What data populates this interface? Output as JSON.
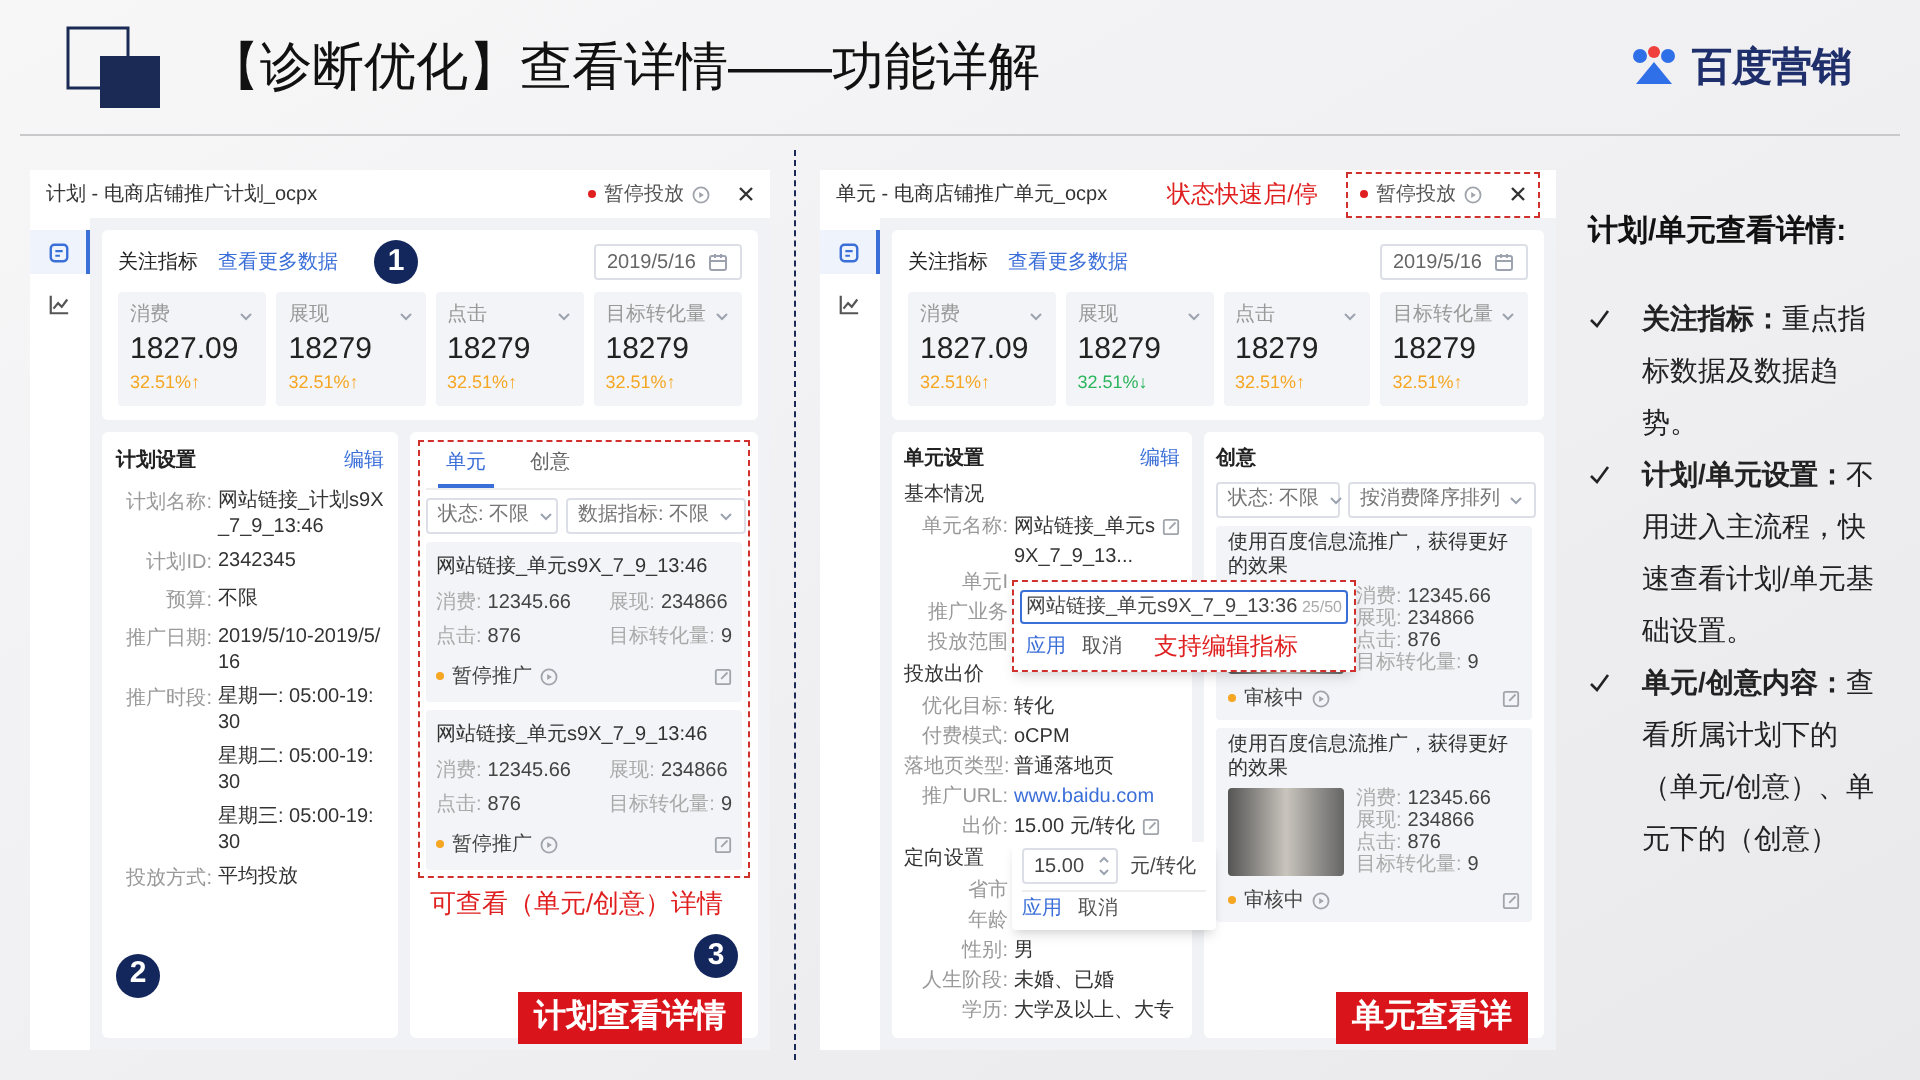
{
  "header": {
    "title": "【诊断优化】查看详情——功能详解",
    "brand": "百度营销"
  },
  "plan_view": {
    "title": "计划 - 电商店铺推广计划_ocpx",
    "status": "暂停投放",
    "nav": [
      {
        "kind": "document",
        "selected": true
      },
      {
        "kind": "chart",
        "selected": false
      }
    ],
    "metrics": {
      "heading": "关注指标",
      "link": "查看更多数据",
      "date": "2019/5/16",
      "badge": "1",
      "cards": [
        {
          "label": "消费",
          "value": "1827.09",
          "change": "32.51%↑",
          "color": "#f5a623"
        },
        {
          "label": "展现",
          "value": "18279",
          "change": "32.51%↑",
          "color": "#f5a623"
        },
        {
          "label": "点击",
          "value": "18279",
          "change": "32.51%↑",
          "color": "#f5a623"
        },
        {
          "label": "目标转化量",
          "value": "18279",
          "change": "32.51%↑",
          "color": "#f5a623"
        }
      ]
    },
    "settings": {
      "heading": "计划设置",
      "edit": "编辑",
      "badge": "2",
      "rows": [
        {
          "label": "计划名称:",
          "value": "网站链接_计划s9X_7_9_13:46"
        },
        {
          "label": "计划ID:",
          "value": "2342345"
        },
        {
          "label": "预算:",
          "value": "不限"
        },
        {
          "label": "推广日期:",
          "value": "2019/5/10-2019/5/16"
        },
        {
          "label": "推广时段:",
          "value": "星期一: 05:00-19:30"
        },
        {
          "value": "星期二: 05:00-19:30"
        },
        {
          "value": "星期三: 05:00-19:30"
        },
        {
          "label": "投放方式:",
          "value": "平均投放"
        }
      ]
    },
    "list": {
      "tabs": [
        {
          "label": "单元",
          "selected": true
        },
        {
          "label": "创意",
          "selected": false
        }
      ],
      "filters": [
        "状态: 不限",
        "数据指标: 不限"
      ],
      "items": [
        {
          "title": "网站链接_单元s9X_7_9_13:46",
          "stats": [
            {
              "label": "消费:",
              "value": "12345.66"
            },
            {
              "label": "展现:",
              "value": "234866"
            },
            {
              "label": "点击:",
              "value": "876"
            },
            {
              "label": "目标转化量:",
              "value": "9"
            }
          ],
          "status": "暂停推广"
        },
        {
          "title": "网站链接_单元s9X_7_9_13:46",
          "stats": [
            {
              "label": "消费:",
              "value": "12345.66"
            },
            {
              "label": "展现:",
              "value": "234866"
            },
            {
              "label": "点击:",
              "value": "876"
            },
            {
              "label": "目标转化量:",
              "value": "9"
            }
          ],
          "status": "暂停推广"
        }
      ],
      "callout": "可查看（单元/创意）详情",
      "badge": "3"
    },
    "button": "计划查看详情"
  },
  "unit_view": {
    "title": "单元 - 电商店铺推广单元_ocpx",
    "status": "暂停投放",
    "status_callout": "状态快速启/停",
    "nav": [
      {
        "kind": "document",
        "selected": true
      },
      {
        "kind": "chart",
        "selected": false
      }
    ],
    "metrics": {
      "heading": "关注指标",
      "link": "查看更多数据",
      "date": "2019/5/16",
      "cards": [
        {
          "label": "消费",
          "value": "1827.09",
          "change": "32.51%↑",
          "color": "#f5a623"
        },
        {
          "label": "展现",
          "value": "18279",
          "change": "32.51%↓",
          "color": "#2db55d"
        },
        {
          "label": "点击",
          "value": "18279",
          "change": "32.51%↑",
          "color": "#f5a623"
        },
        {
          "label": "目标转化量",
          "value": "18279",
          "change": "32.51%↑",
          "color": "#f5a623"
        }
      ]
    },
    "settings": {
      "heading": "单元设置",
      "edit": "编辑",
      "groups": [
        {
          "title": "基本情况",
          "rows": [
            {
              "label": "单元名称:",
              "value": "网站链接_单元s9X_7_9_13...",
              "kind": "text",
              "editable": true
            },
            {
              "label": "单元I"
            },
            {
              "label": "推广业务"
            },
            {
              "label": "投放范围"
            }
          ]
        },
        {
          "title": "投放出价",
          "rows": [
            {
              "label": "优化目标:",
              "value": "转化",
              "kind": "text",
              "editable": false
            },
            {
              "label": "付费模式:",
              "value": "oCPM",
              "kind": "text",
              "editable": false
            },
            {
              "label": "落地页类型:",
              "value": "普通落地页",
              "kind": "text",
              "editable": false
            },
            {
              "label": "推广URL:",
              "value": "www.baidu.com",
              "kind": "link",
              "editable": false
            },
            {
              "label": "出价:",
              "value": "15.00 元/转化",
              "kind": "text",
              "editable": true
            }
          ]
        },
        {
          "title": "定向设置",
          "rows": [
            {
              "label": "省市"
            },
            {
              "label": "年龄"
            },
            {
              "label": "性别:",
              "value": "男",
              "kind": "text",
              "editable": false
            },
            {
              "label": "人生阶段:",
              "value": "未婚、已婚",
              "kind": "text",
              "editable": false
            },
            {
              "label": "学历:",
              "value": "大学及以上、大专",
              "kind": "text",
              "editable": false
            }
          ]
        }
      ]
    },
    "name_editor": {
      "value": "网站链接_单元s9X_7_9_13:36",
      "counter": "25/50",
      "apply": "应用",
      "cancel": "取消",
      "callout": "支持编辑指标"
    },
    "bid_editor": {
      "value": "15.00",
      "unit": "元/转化",
      "apply": "应用",
      "cancel": "取消"
    },
    "creatives": {
      "heading": "创意",
      "filters": [
        "状态: 不限",
        "按消费降序排列"
      ],
      "items": [
        {
          "title": "使用百度信息流推广，获得更好的效果",
          "stats": [
            {
              "label": "消费:",
              "value": "12345.66"
            },
            {
              "label": "展现:",
              "value": "234866"
            },
            {
              "label": "点击:",
              "value": "876"
            },
            {
              "label": "目标转化量:",
              "value": "9"
            }
          ],
          "status": "审核中"
        },
        {
          "title": "使用百度信息流推广，获得更好的效果",
          "stats": [
            {
              "label": "消费:",
              "value": "12345.66"
            },
            {
              "label": "展现:",
              "value": "234866"
            },
            {
              "label": "点击:",
              "value": "876"
            },
            {
              "label": "目标转化量:",
              "value": "9"
            }
          ],
          "status": "审核中"
        }
      ]
    },
    "button": "单元查看详"
  },
  "notes": {
    "title": "计划/单元查看详情:",
    "bullets": [
      "**关注指标：**重点指标数据及数据趋势。",
      "**计划/单元设置：**不用进入主流程，快速查看计划/单元基础设置。",
      "**单元/创意内容：**查看所属计划下的（单元/创意）、单元下的（创意）"
    ]
  }
}
